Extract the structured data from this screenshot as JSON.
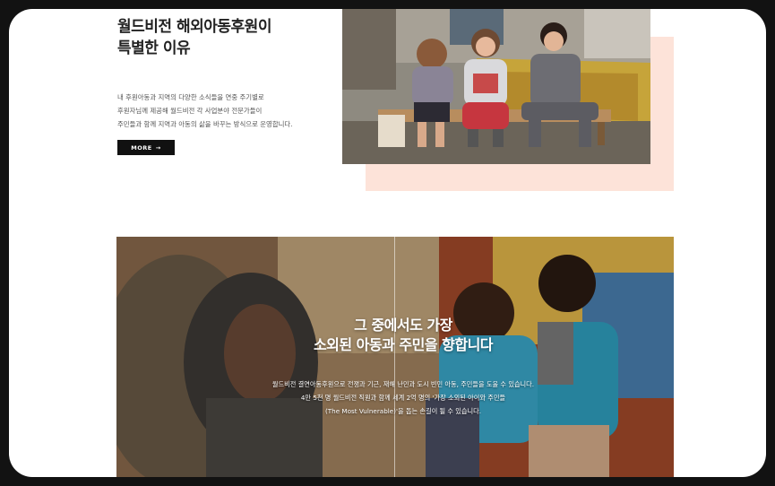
{
  "intro": {
    "title_line1": "월드비전 해외아동후원이",
    "title_line2": "특별한 이유",
    "desc_line1": "내 후원아동과 지역의 다양한 소식들을 연중 주기별로",
    "desc_line2": "후원자님께 제공해 월드비전 각 사업분야 전문가들이",
    "desc_line3": "주민들과 함께 지역과 아동의 삶을 바꾸는 방식으로 운영합니다.",
    "more_label": "MORE",
    "more_arrow": "→"
  },
  "banner": {
    "headline_line1": "그 중에서도 가장",
    "headline_line2": "소외된 아동과 주민을 향합니다",
    "body_line1": "월드비전 결연아동후원으로 전쟁과 기근, 재해 난민과 도시 빈민 아동, 주민들을 도울 수 있습니다.",
    "body_line2": "4만 5천 명 월드비전 직원과 함께 세계 2억 명의 '가장 소외된 아이와 주민들",
    "body_line3": "(The Most Vulnerable)'을 돕는 손길이 될 수 있습니다."
  },
  "colors": {
    "accent_peach": "#fde3d9",
    "button_bg": "#111111"
  },
  "icons": {
    "more_arrow": "arrow-right-icon"
  }
}
